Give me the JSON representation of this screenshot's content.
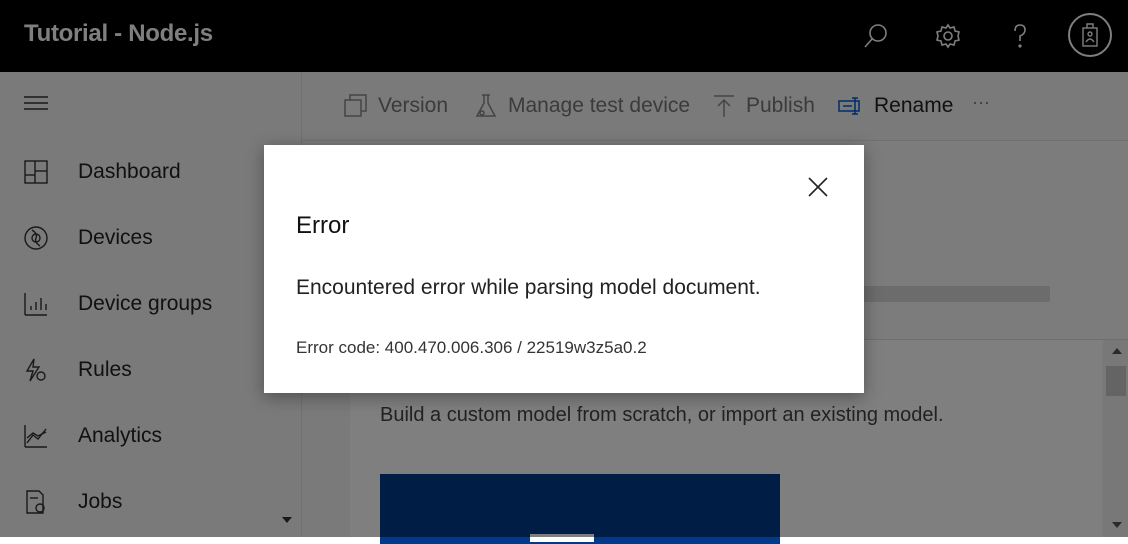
{
  "header": {
    "title": "Tutorial - Node.js",
    "icons": [
      "search-icon",
      "gear-icon",
      "help-icon",
      "avatar"
    ]
  },
  "sidebar": {
    "items": [
      {
        "label": "Dashboard",
        "icon": "dashboard-icon"
      },
      {
        "label": "Devices",
        "icon": "devices-icon"
      },
      {
        "label": "Device groups",
        "icon": "device-groups-icon"
      },
      {
        "label": "Rules",
        "icon": "rules-icon"
      },
      {
        "label": "Analytics",
        "icon": "analytics-icon"
      },
      {
        "label": "Jobs",
        "icon": "jobs-icon"
      }
    ]
  },
  "toolbar": {
    "version_label": "Version",
    "manage_label": "Manage test device",
    "publish_label": "Publish",
    "rename_label": "Rename",
    "more_label": "···"
  },
  "main": {
    "card_description": "Build a custom model from scratch, or import an existing model."
  },
  "dialog": {
    "title": "Error",
    "message": "Encountered error while parsing model document.",
    "code": "Error code: 400.470.006.306 / 22519w3z5a0.2"
  },
  "colors": {
    "header_bg": "#000000",
    "accent": "#0058d1",
    "card_image": "#003a8c"
  }
}
